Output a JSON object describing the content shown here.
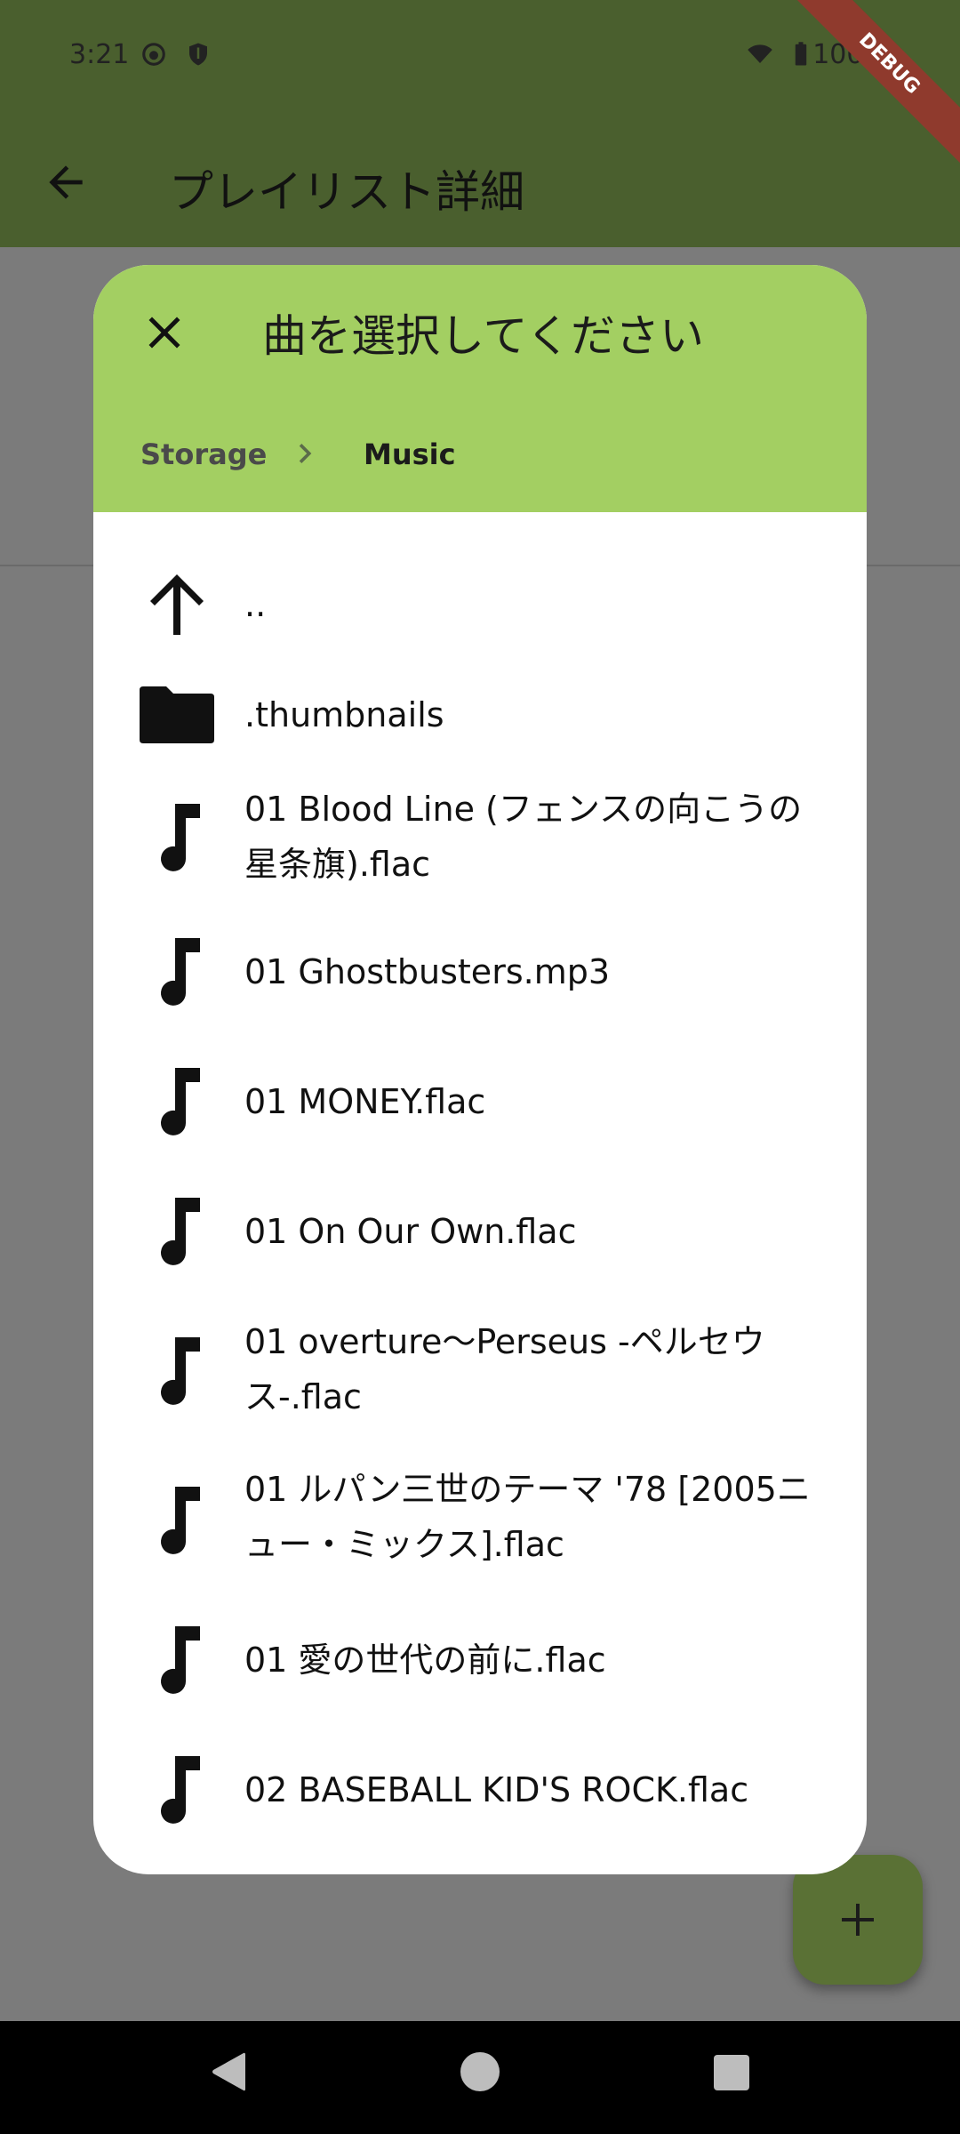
{
  "status_bar": {
    "time": "3:21",
    "battery": "100%"
  },
  "app_bar": {
    "title": "プレイリスト詳細"
  },
  "debug_banner": "DEBUG",
  "dialog": {
    "title": "曲を選択してください",
    "breadcrumb": [
      "Storage",
      "Music"
    ],
    "items": [
      {
        "type": "up",
        "label": ".."
      },
      {
        "type": "folder",
        "label": ".thumbnails"
      },
      {
        "type": "audio",
        "label": "01 Blood Line (フェンスの向こうの星条旗).flac"
      },
      {
        "type": "audio",
        "label": "01 Ghostbusters.mp3"
      },
      {
        "type": "audio",
        "label": "01 MONEY.flac"
      },
      {
        "type": "audio",
        "label": "01 On Our Own.flac"
      },
      {
        "type": "audio",
        "label": "01 overture〜Perseus -ペルセウス-.flac"
      },
      {
        "type": "audio",
        "label": "01 ルパン三世のテーマ '78 [2005ニュー・ミックス].flac"
      },
      {
        "type": "audio",
        "label": "01 愛の世代の前に.flac"
      },
      {
        "type": "audio",
        "label": "02 BASEBALL KID'S ROCK.flac"
      }
    ]
  },
  "colors": {
    "header_green": "#a3cf62",
    "appbar_dimmed": "#4a5f2e",
    "scrim": "#7b7b7b",
    "fab": "#5a7135"
  },
  "icons": {
    "back": "arrow-back-icon",
    "close": "close-icon",
    "up": "arrow-up-icon",
    "folder": "folder-icon",
    "audio": "music-note-icon",
    "fab": "add-icon"
  }
}
